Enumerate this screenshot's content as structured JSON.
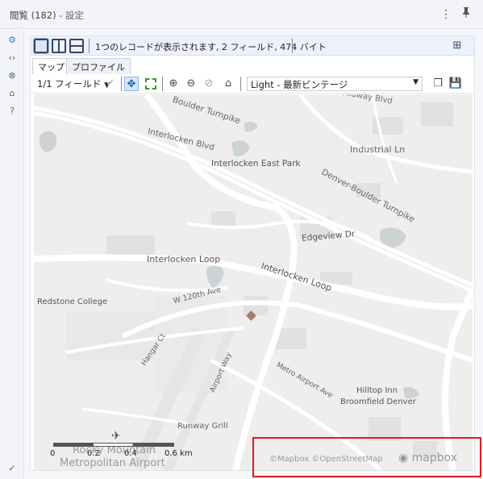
{
  "header": {
    "title": "閲覧 (182)",
    "subtitle": "- 設定"
  },
  "toolbar": {
    "record_info": "1つのレコードが表示されます, 2 フィールド, 474 バイト"
  },
  "tabs": [
    {
      "label": "マップ"
    },
    {
      "label": "プロファイル"
    }
  ],
  "map_toolbar": {
    "field_selector": "1/1 フィールド",
    "style_selector": "Light - 最新ビンテージ"
  },
  "map": {
    "labels": [
      {
        "text": "Midway Blvd"
      },
      {
        "text": "Boulder Turnpike"
      },
      {
        "text": "Interlocken Blvd"
      },
      {
        "text": "Industrial Ln"
      },
      {
        "text": "Interlocken East Park"
      },
      {
        "text": "Denver-Boulder Turnpike"
      },
      {
        "text": "Edgeview Dr"
      },
      {
        "text": "Interlocken Loop"
      },
      {
        "text": "Interlocken Loop"
      },
      {
        "text": "W 120th Ave"
      },
      {
        "text": "Redstone College"
      },
      {
        "text": "Hangar Ct"
      },
      {
        "text": "Airport Way"
      },
      {
        "text": "Metro Airport Ave"
      },
      {
        "text": "Hilltop Inn"
      },
      {
        "text": "Broomfield Denver"
      },
      {
        "text": "Runway Grill"
      },
      {
        "text": "Rocky Mountain"
      },
      {
        "text": "Metropolitan Airport"
      }
    ],
    "scale_labels": [
      "0",
      "0.2",
      "0.4",
      "0.6 km"
    ],
    "attribution": "©Mapbox ©OpenStreetMap",
    "logo": "mapbox",
    "marker_color": "#a77a72"
  }
}
